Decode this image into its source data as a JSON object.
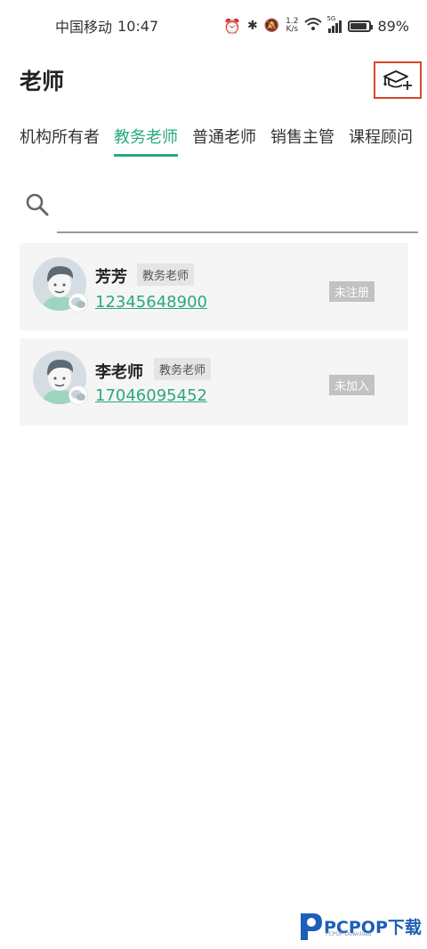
{
  "status_bar": {
    "carrier": "中国移动",
    "time": "10:47",
    "speed_top": "1.2",
    "speed_bottom": "K/s",
    "signal_label": "5G",
    "battery": "89%",
    "battery_level": 0.89
  },
  "header": {
    "title": "老师",
    "add_icon": "graduation-cap-plus-icon"
  },
  "tabs": [
    {
      "label": "机构所有者",
      "active": false
    },
    {
      "label": "教务老师",
      "active": true
    },
    {
      "label": "普通老师",
      "active": false
    },
    {
      "label": "销售主管",
      "active": false
    },
    {
      "label": "课程顾问",
      "active": false
    }
  ],
  "search": {
    "placeholder": ""
  },
  "teachers": [
    {
      "name": "芳芳",
      "role": "教务老师",
      "phone": "12345648900",
      "status": "未注册"
    },
    {
      "name": "李老师",
      "role": "教务老师",
      "phone": "17046095452",
      "status": "未加入"
    }
  ],
  "watermark": {
    "brand": "PCPOP下载",
    "sub": "PCPOP Download"
  },
  "colors": {
    "accent": "#2aa87e",
    "highlight_border": "#d9452d",
    "card_bg": "#f5f5f5"
  }
}
